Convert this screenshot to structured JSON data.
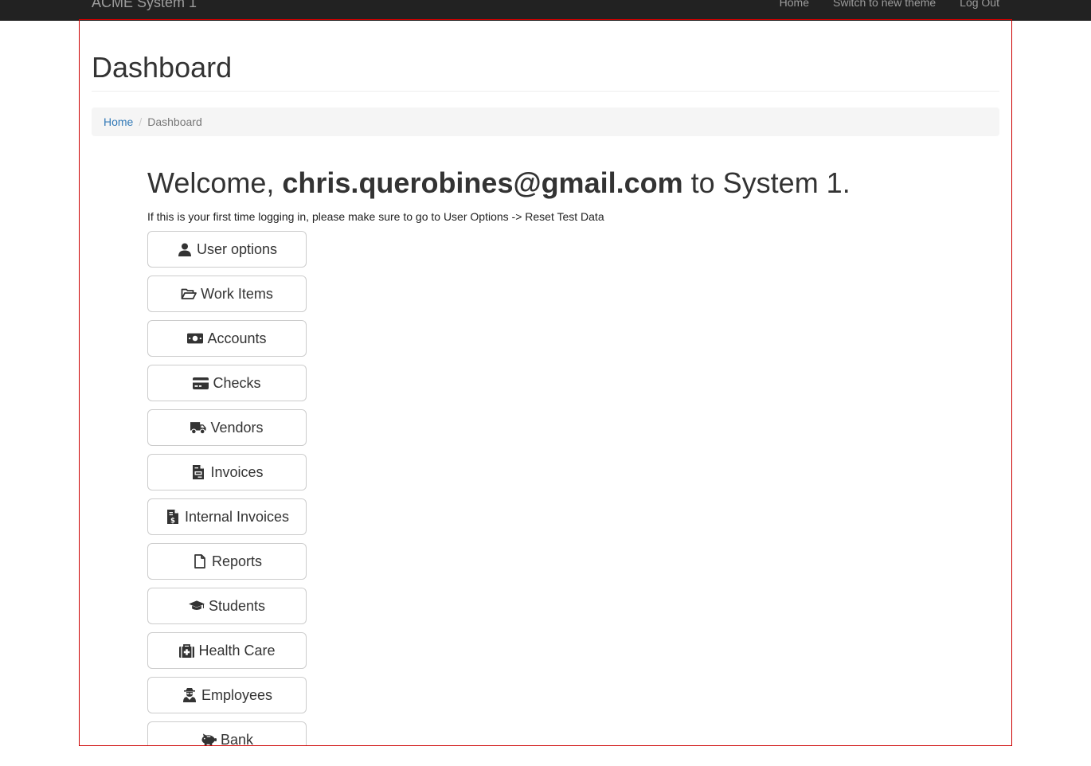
{
  "navbar": {
    "brand": "ACME System 1",
    "links": [
      {
        "label": "Home"
      },
      {
        "label": "Switch to new theme"
      },
      {
        "label": "Log Out"
      }
    ]
  },
  "page": {
    "title": "Dashboard",
    "breadcrumb": {
      "home": "Home",
      "separator": "/",
      "current": "Dashboard"
    }
  },
  "welcome": {
    "prefix": "Welcome, ",
    "user": "chris.querobines@gmail.com",
    "suffix": " to System 1.",
    "notice": "If this is your first time logging in, please make sure to go to User Options -> Reset Test Data"
  },
  "buttons": [
    {
      "label": "User options",
      "icon": "user-icon"
    },
    {
      "label": "Work Items",
      "icon": "folder-open-icon"
    },
    {
      "label": "Accounts",
      "icon": "money-icon"
    },
    {
      "label": "Checks",
      "icon": "credit-card-icon"
    },
    {
      "label": "Vendors",
      "icon": "truck-icon"
    },
    {
      "label": "Invoices",
      "icon": "invoice-icon"
    },
    {
      "label": "Internal Invoices",
      "icon": "file-invoice-dollar-icon"
    },
    {
      "label": "Reports",
      "icon": "file-icon"
    },
    {
      "label": "Students",
      "icon": "graduation-cap-icon"
    },
    {
      "label": "Health Care",
      "icon": "medkit-icon"
    },
    {
      "label": "Employees",
      "icon": "user-secret-icon"
    },
    {
      "label": "Bank",
      "icon": "piggy-bank-icon"
    }
  ],
  "colors": {
    "navbar_bg": "#222222",
    "link": "#337ab7",
    "frame_border": "#cc0000",
    "breadcrumb_bg": "#f5f5f5"
  }
}
